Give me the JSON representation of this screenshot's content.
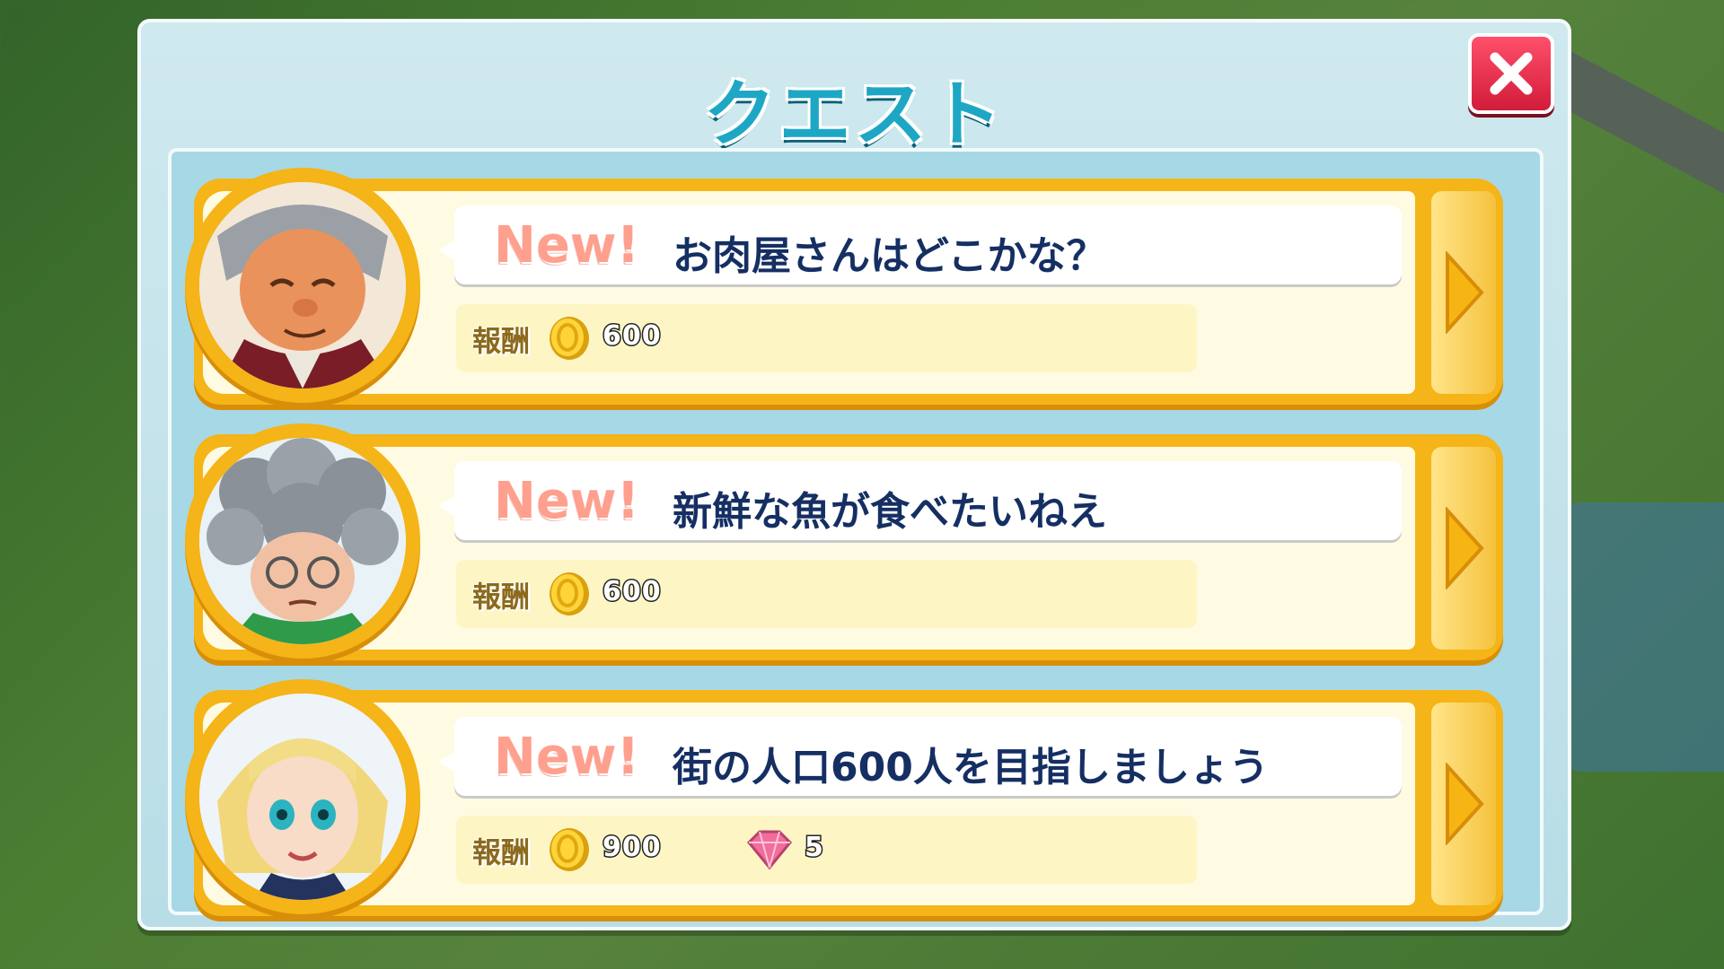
{
  "dialog": {
    "title": "クエスト"
  },
  "colors": {
    "accent": "#1ea7c5",
    "card": "#f5b417",
    "close": "#e8253f",
    "new_badge": "#ff9f8d",
    "quest_text": "#152f63"
  },
  "quests": [
    {
      "badge": "New!",
      "text": "お肉屋さんはどこかな？",
      "reward_label": "報酬",
      "coins": "600",
      "gems": null,
      "avatar": "old-man-avatar"
    },
    {
      "badge": "New!",
      "text": "新鮮な魚が食べたいねえ",
      "reward_label": "報酬",
      "coins": "600",
      "gems": null,
      "avatar": "old-woman-avatar"
    },
    {
      "badge": "New!",
      "text": "街の人口600人を目指しましょう",
      "reward_label": "報酬",
      "coins": "900",
      "gems": "5",
      "avatar": "police-girl-avatar"
    }
  ]
}
